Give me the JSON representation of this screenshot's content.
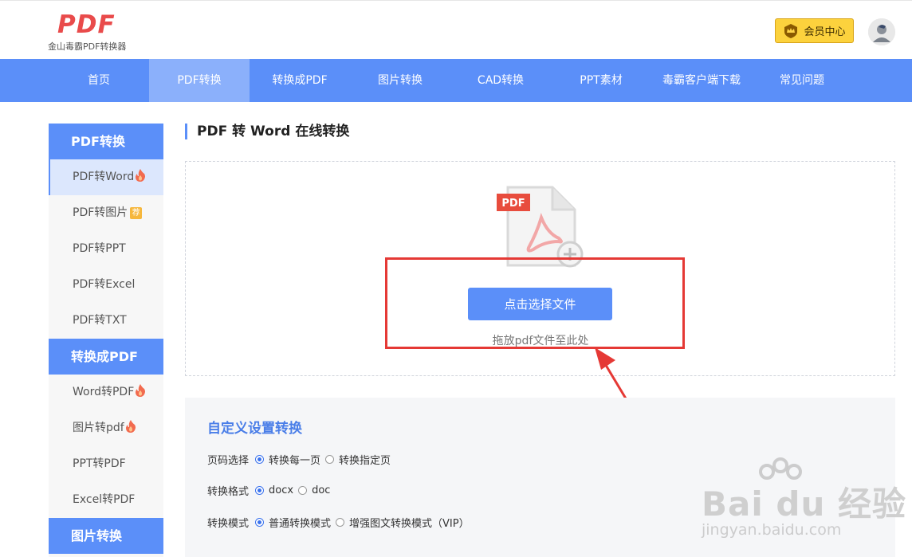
{
  "header": {
    "logo_mark": "PDF",
    "logo_subtitle": "金山毒霸PDF转换器",
    "vip_label": "会员中心"
  },
  "nav": {
    "items": [
      {
        "label": "首页"
      },
      {
        "label": "PDF转换"
      },
      {
        "label": "转换成PDF"
      },
      {
        "label": "图片转换"
      },
      {
        "label": "CAD转换"
      },
      {
        "label": "PPT素材"
      },
      {
        "label": "毒霸客户端下载"
      },
      {
        "label": "常见问题"
      }
    ],
    "active": "PDF转换"
  },
  "sidebar": {
    "sections": [
      {
        "title": "PDF转换",
        "items": [
          {
            "label": "PDF转Word",
            "badge": "hot"
          },
          {
            "label": "PDF转图片",
            "badge": "rec",
            "badge_text": "荐"
          },
          {
            "label": "PDF转PPT"
          },
          {
            "label": "PDF转Excel"
          },
          {
            "label": "PDF转TXT"
          }
        ]
      },
      {
        "title": "转换成PDF",
        "items": [
          {
            "label": "Word转PDF",
            "badge": "hot"
          },
          {
            "label": "图片转pdf",
            "badge": "hot"
          },
          {
            "label": "PPT转PDF"
          },
          {
            "label": "Excel转PDF"
          }
        ]
      },
      {
        "title": "图片转换",
        "items": []
      }
    ],
    "active_item": "PDF转Word"
  },
  "main": {
    "title": "PDF 转 Word 在线转换",
    "upload": {
      "file_badge": "PDF",
      "button_label": "点击选择文件",
      "hint": "拖放pdf文件至此处"
    },
    "settings": {
      "title": "自定义设置转换",
      "rows": [
        {
          "label": "页码选择",
          "options": [
            "转换每一页",
            "转换指定页"
          ],
          "selected": 0
        },
        {
          "label": "转换格式",
          "options": [
            "docx",
            "doc"
          ],
          "selected": 0
        },
        {
          "label": "转换模式",
          "options": [
            "普通转换模式",
            "增强图文转换模式（VIP）"
          ],
          "selected": 0
        }
      ]
    }
  },
  "watermark": {
    "brand": "Bai du 经验",
    "url": "jingyan.baidu.com"
  },
  "colors": {
    "primary": "#5b8ff9",
    "nav_active": "#8bb0fb",
    "annotation_red": "#e53935",
    "vip_gold": "#fcd23d",
    "settings_title": "#4a7ee8"
  }
}
